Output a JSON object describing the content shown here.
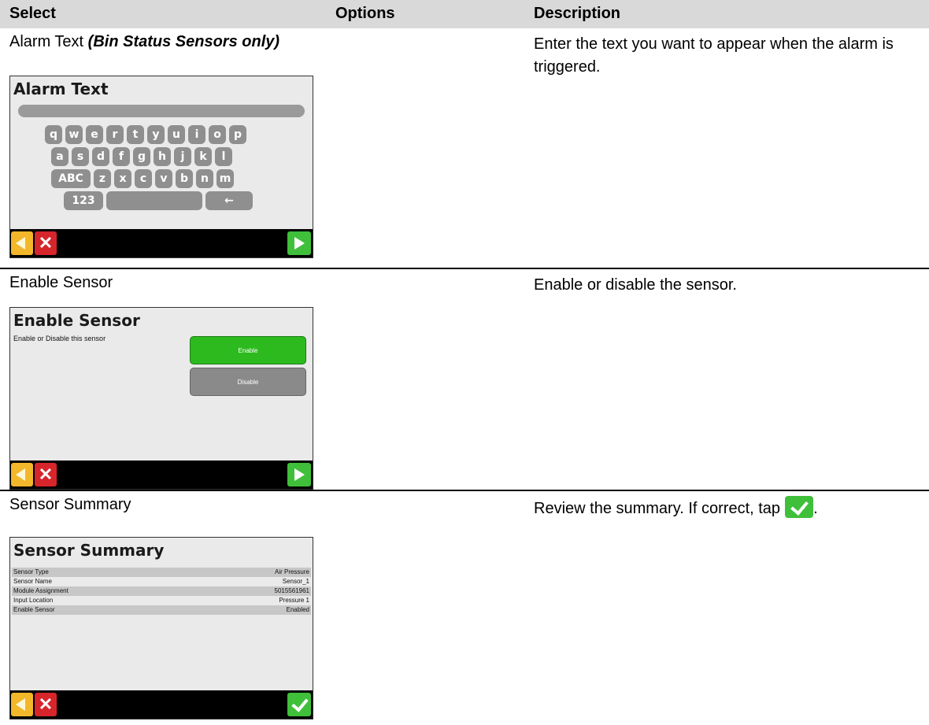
{
  "header": {
    "col_select": "Select",
    "col_options": "Options",
    "col_description": "Description"
  },
  "rows": [
    {
      "select_label": "Alarm Text ",
      "select_label_emphasis": "(Bin Status Sensors only)",
      "description": "Enter the text you want to appear when the alarm is triggered.",
      "screen": {
        "title": "Alarm Text",
        "keyboard": {
          "row1": [
            "q",
            "w",
            "e",
            "r",
            "t",
            "y",
            "u",
            "i",
            "o",
            "p"
          ],
          "row2": [
            "a",
            "s",
            "d",
            "f",
            "g",
            "h",
            "j",
            "k",
            "l"
          ],
          "row3": [
            "ABC",
            "z",
            "x",
            "c",
            "v",
            "b",
            "n",
            "m"
          ],
          "row4": [
            "123",
            "",
            "←"
          ]
        }
      }
    },
    {
      "select_label": "Enable Sensor",
      "description": "Enable or disable the sensor.",
      "screen": {
        "title": "Enable Sensor",
        "prompt": "Enable or Disable this sensor",
        "enable_label": "Enable",
        "disable_label": "Disable"
      }
    },
    {
      "select_label": "Sensor Summary",
      "description": "Review the summary. If correct, tap",
      "description_end": ".",
      "screen": {
        "title": "Sensor Summary",
        "summary": [
          {
            "label": "Sensor Type",
            "value": "Air Pressure"
          },
          {
            "label": "Sensor Name",
            "value": "Sensor_1"
          },
          {
            "label": "Module Assignment",
            "value": "5015561961"
          },
          {
            "label": "Input Location",
            "value": "Pressure 1"
          },
          {
            "label": "Enable Sensor",
            "value": "Enabled"
          }
        ]
      }
    }
  ],
  "icons": {
    "back": "back-arrow-icon",
    "cancel": "cancel-x-icon",
    "next": "next-arrow-icon",
    "confirm": "checkmark-icon"
  },
  "colors": {
    "header_bg": "#d9d9d9",
    "accept_green": "#3fbf3a",
    "cancel_red": "#d6252b",
    "back_yellow": "#f2b72a"
  }
}
